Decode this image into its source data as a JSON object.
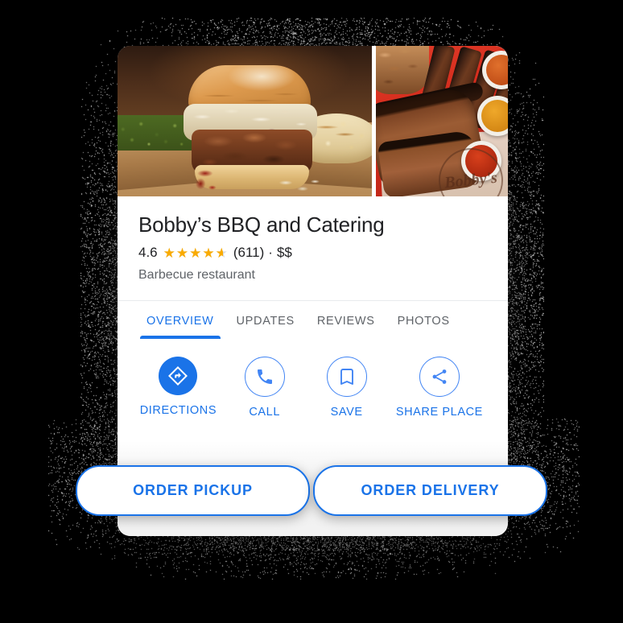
{
  "card": {
    "photos": [
      {
        "name": "pulled-pork-sandwich-photo",
        "alt": "Pulled pork sandwich with coleslaw, green beans and potato salad"
      },
      {
        "name": "brisket-ribs-sauces-photo",
        "alt": "Sliced brisket and ribs on red tray with three sauce cups",
        "stamp_text": "Bobby's"
      }
    ],
    "business_name": "Bobby’s BBQ and Catering",
    "rating": {
      "value": "4.6",
      "value_number": 4.6,
      "stars_glyph": "★★★★★",
      "fill_percent": "92%",
      "review_count": "(611)",
      "separator": "·",
      "price_level": "$$"
    },
    "category": "Barbecue restaurant",
    "tabs": [
      {
        "label": "OVERVIEW",
        "active": true
      },
      {
        "label": "UPDATES",
        "active": false
      },
      {
        "label": "REVIEWS",
        "active": false
      },
      {
        "label": "PHOTOS",
        "active": false
      }
    ],
    "actions": [
      {
        "label": "DIRECTIONS",
        "icon": "directions-icon",
        "style": "filled"
      },
      {
        "label": "CALL",
        "icon": "phone-icon",
        "style": "outline"
      },
      {
        "label": "SAVE",
        "icon": "bookmark-icon",
        "style": "outline"
      },
      {
        "label": "SHARE PLACE",
        "icon": "share-icon",
        "style": "outline"
      }
    ],
    "order_buttons": [
      {
        "label": "ORDER PICKUP"
      },
      {
        "label": "ORDER DELIVERY"
      }
    ]
  },
  "colors": {
    "accent_blue": "#1a73e8",
    "outline_blue": "#4285f4",
    "star_gold": "#f9ab00",
    "text_primary": "#202124",
    "text_secondary": "#5f6368",
    "background": "#000000",
    "card": "#ffffff"
  }
}
